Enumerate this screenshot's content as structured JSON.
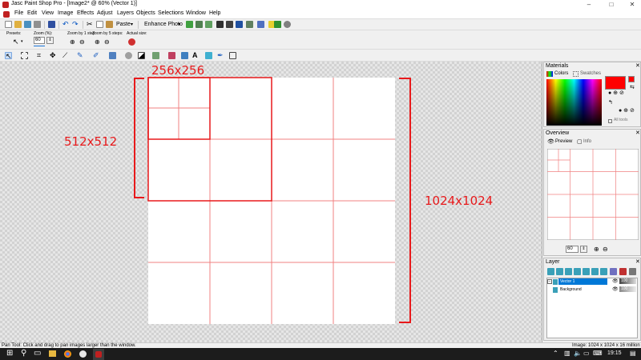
{
  "window": {
    "title": "Jasc Paint Shop Pro - [Image2* @ 60% (Vector 1)]",
    "minimize": "–",
    "maximize": "□",
    "close": "✕"
  },
  "menu": [
    "File",
    "Edit",
    "View",
    "Image",
    "Effects",
    "Adjust",
    "Layers",
    "Objects",
    "Selections",
    "Window",
    "Help"
  ],
  "toolbar": {
    "paste_label": "Paste",
    "enhance_label": "Enhance Photo"
  },
  "tool_options": {
    "presets_label": "Presets:",
    "zoom_label": "Zoom (%):",
    "zoom_value": "60",
    "zoom_by_1_label": "Zoom by 1 step:",
    "zoom_by_5_label": "Zoom by 5 steps:",
    "actual_size_label": "Actual size:"
  },
  "annotations": {
    "label_256": "256x256",
    "label_512": "512x512",
    "label_1024": "1024x1024"
  },
  "materials": {
    "title": "Materials",
    "tab_colors": "Colors",
    "tab_swatches": "Swatches",
    "all_tools": "All tools",
    "foreground_color": "#ff0000"
  },
  "overview": {
    "title": "Overview",
    "tab_preview": "Preview",
    "tab_info": "Info",
    "zoom_value": "60"
  },
  "layers": {
    "title": "Layer",
    "items": [
      {
        "name": "Vector 1",
        "opacity": "100"
      },
      {
        "name": "Background",
        "opacity": "100"
      }
    ]
  },
  "status": {
    "left": "Pan Tool: Click and drag to pan images larger than the window.",
    "right": "Image:  1024 x 1024 x 16 million"
  },
  "taskbar": {
    "time": "19:15"
  },
  "colors": {
    "accent": "#e8191b",
    "grid_line": "#f08080",
    "selected_layer": "#0078d7"
  }
}
